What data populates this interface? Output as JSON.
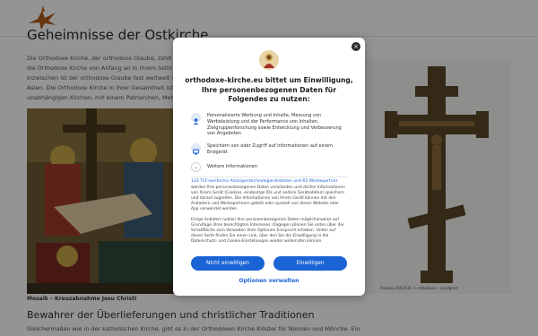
{
  "page": {
    "title": "Geheimnisse der Ostkirche",
    "intro_lines": [
      "Die Orthodoxe Kirche, der orthodoxe Glaube, zählt zu den",
      "die Orthodoxe Kirche von Anfang an in ihrem östlich geleg",
      "Inzwischen ist der orthodoxe Glaube fast weltweit verbr",
      "Asien. Die Orthodoxe Kirche in ihrer Gesamtheit ist eine",
      "unabhängigen Kirchen, mit einem Patriarchen, Metropol"
    ],
    "image_caption": "Mosaik – Kreuzabnahme Jesu Christi",
    "subheading": "Bewahrer der Überlieferungen und christlicher Traditionen",
    "body_line": "Gleichermaßen wie in der katholischen Kirche, gibt es in der Orthodoxen Kirche Klöster für Nonnen und Mönche. Eine",
    "cross_credit": "Pixabay 4583434 © orthodoxie – pixelgeist"
  },
  "dialog": {
    "title": "orthodoxe-kirche.eu bittet um Einwilligung, Ihre personenbezogenen Daten für Folgendes zu nutzen:",
    "purposes": [
      {
        "icon": "person-icon",
        "text": "Personalisierte Werbung und Inhalte, Messung von Werbeleistung und der Performance von Inhalten, Zielgruppenforschung sowie Entwicklung und Verbesserung von Angeboten"
      },
      {
        "icon": "device-icon",
        "text": "Speichern von oder Zugriff auf Informationen auf einem Endgerät"
      }
    ],
    "more_info_label": "Weitere Informationen",
    "vendors_link": "132 TCF-konforme Anzeigentechnologie-Anbieter und 65 Werbepartner",
    "paragraph1": [
      "werden Ihre personenbezogenen Daten verarbeiten und dürfen Informationen",
      "von Ihrem Gerät (Cookies, eindeutige IDs und andere Gerätedaten) speichern",
      "und darauf zugreifen. Die Informationen von Ihrem Gerät können mit den",
      "Anbietern und Werbepartnern geteilt oder speziell von dieser Website oder",
      "App verwendet werden."
    ],
    "paragraph2": [
      "Einige Anbieter nutzen Ihre personenbezogenen Daten möglicherweise auf",
      "Grundlage ihres berechtigten Interesses. Dagegen können Sie unten über die",
      "Schaltfläche zum Verwalten Ihrer Optionen Einspruch erheben. Unten auf",
      "dieser Seite finden Sie einen Link, über den Sie die Einwilligung in die",
      "Datenschutz- und Cookie-Einstellungen wieder widerrufen können."
    ],
    "decline_label": "Nicht einwilligen",
    "accept_label": "Einwilligen",
    "manage_label": "Optionen verwalten",
    "close_label": "×"
  },
  "colors": {
    "accent": "#1a64d6",
    "overlay": "rgba(0,0,0,0.42)"
  }
}
